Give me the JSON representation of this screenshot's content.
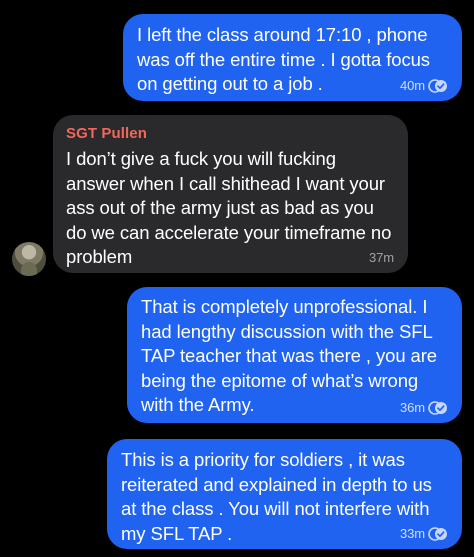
{
  "messages": [
    {
      "direction": "outgoing",
      "text": "I left the class around 17:10 , phone was off the entire time . I gotta focus on getting out to a job .",
      "time": "40m",
      "read_icon": "double-check-read-icon"
    },
    {
      "direction": "incoming",
      "sender": "SGT Pullen",
      "text": "I don’t give a fuck you will fucking answer when I call shithead I want your ass out of the army just as bad as you do we can accelerate your timeframe no problem",
      "time": "37m",
      "avatar_icon": "profile-photo-avatar"
    },
    {
      "direction": "outgoing",
      "text": "That is completely unprofessional. I had lengthy discussion with the SFL TAP teacher that was there , you are being the epitome of what’s wrong with the Army.",
      "time": "36m",
      "read_icon": "double-check-read-icon"
    },
    {
      "direction": "outgoing",
      "text": "This is a priority for soldiers , it was reiterated and explained in depth to us at the class . You will not interfere with my SFL TAP .",
      "time": "33m",
      "read_icon": "double-check-read-icon"
    }
  ],
  "colors": {
    "background": "#000000",
    "outgoing_bubble": "#1f63f0",
    "incoming_bubble": "#2a2a2c",
    "sender_name": "#f2675c",
    "text": "#ffffff"
  }
}
